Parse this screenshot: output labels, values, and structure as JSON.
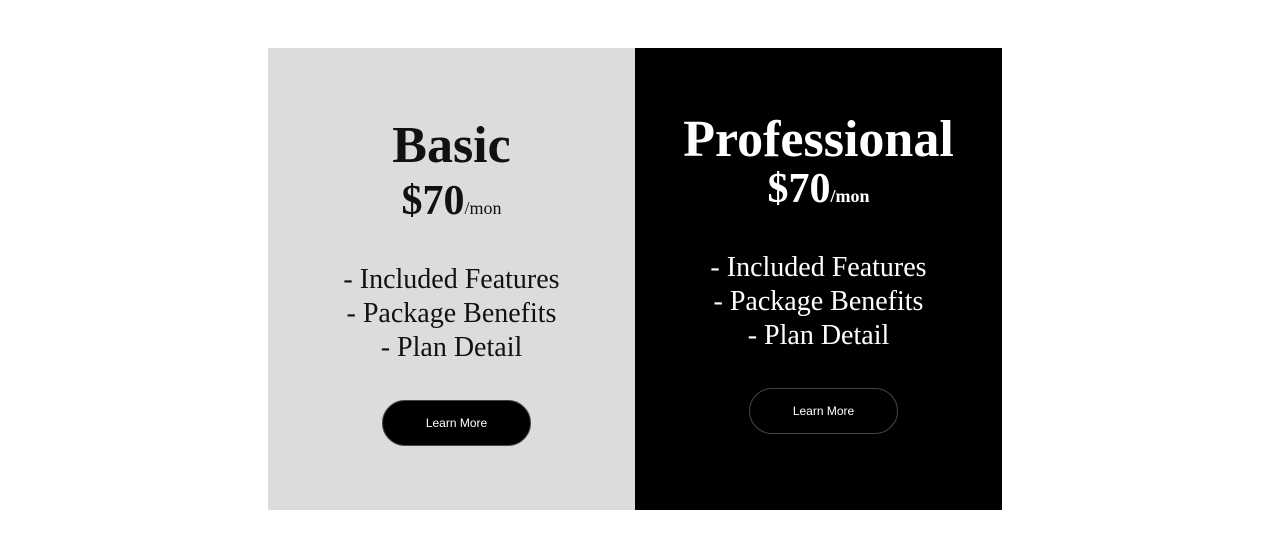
{
  "plans": [
    {
      "name": "Basic",
      "price": "$70",
      "period": "/mon",
      "features": [
        "- Included Features",
        "- Package Benefits",
        "- Plan Detail"
      ],
      "button_label": "Learn More"
    },
    {
      "name": "Professional",
      "price": "$70",
      "period": "/mon",
      "features": [
        "- Included Features",
        "- Package Benefits",
        "- Plan Detail"
      ],
      "button_label": "Learn More"
    }
  ],
  "colors": {
    "basic_background": "#dcdcdc",
    "pro_background": "#000000",
    "button_background": "#000000",
    "button_text": "#ffffff"
  }
}
